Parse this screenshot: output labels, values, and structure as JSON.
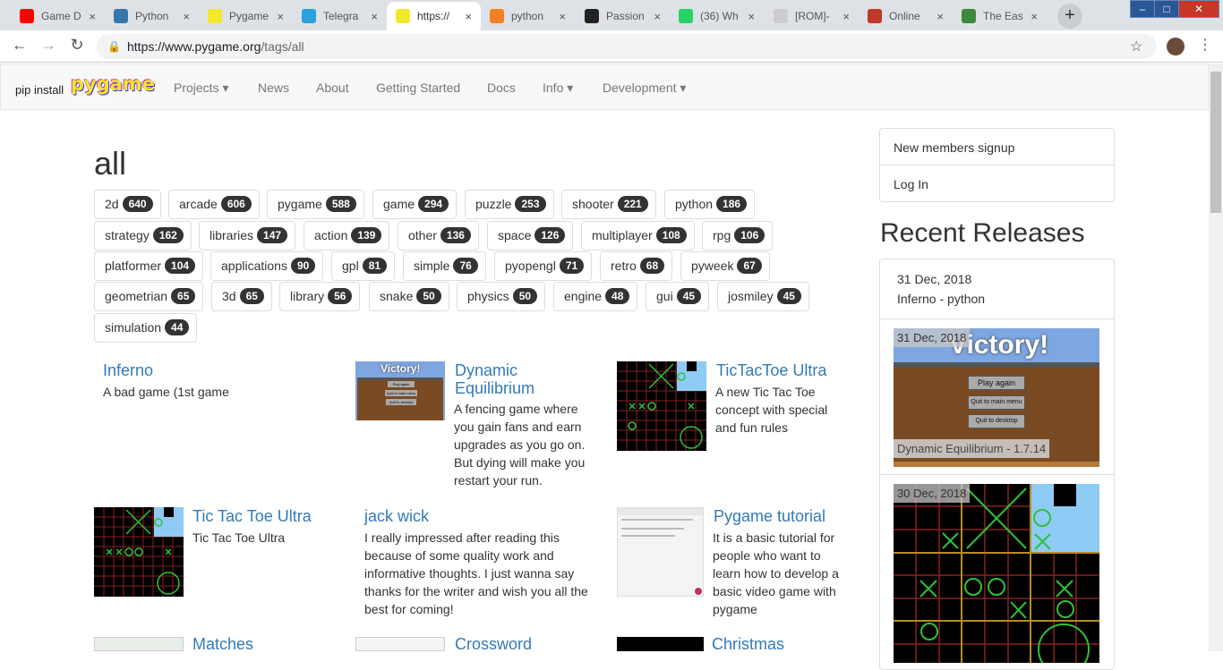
{
  "browser": {
    "tabs": [
      {
        "title": "Game D",
        "icon": "youtube-icon",
        "color": "#ff0000"
      },
      {
        "title": "Python",
        "icon": "python-icon",
        "color": "#3776ab"
      },
      {
        "title": "Pygame",
        "icon": "pygame-snake-icon",
        "color": "#f2e72a"
      },
      {
        "title": "Telegra",
        "icon": "telegram-icon",
        "color": "#2aa1da"
      },
      {
        "title": "https://",
        "icon": "pygame-snake-icon",
        "color": "#f2e72a"
      },
      {
        "title": "python",
        "icon": "stackoverflow-icon",
        "color": "#f48024"
      },
      {
        "title": "Passion",
        "icon": "github-icon",
        "color": "#222222"
      },
      {
        "title": "(36) Wh",
        "icon": "whatsapp-icon",
        "color": "#25d366"
      },
      {
        "title": "[ROM]-",
        "icon": "xda-icon",
        "color": "#cccccc"
      },
      {
        "title": "Online",
        "icon": "online-icon",
        "color": "#c0392b"
      },
      {
        "title": "The Eas",
        "icon": "sheet-icon",
        "color": "#3c8a3c"
      }
    ],
    "close_glyph": "×",
    "new_tab_glyph": "+",
    "window_controls": {
      "minimize": "–",
      "maximize": "□",
      "close": "✕"
    },
    "back_glyph": "←",
    "forward_glyph": "→",
    "reload_glyph": "↻",
    "lock_glyph": "🔒",
    "url_host": "https://www.pygame.org",
    "url_path": "/tags/all",
    "star_glyph": "☆",
    "menu_glyph": "⋮"
  },
  "nav": {
    "brand": "pip install",
    "logo": "pygame",
    "links": [
      "Projects ▾",
      "News",
      "About",
      "Getting Started",
      "Docs",
      "Info ▾",
      "Development ▾"
    ]
  },
  "heading": "all",
  "tags": [
    {
      "name": "2d",
      "count": "640"
    },
    {
      "name": "arcade",
      "count": "606"
    },
    {
      "name": "pygame",
      "count": "588"
    },
    {
      "name": "game",
      "count": "294"
    },
    {
      "name": "puzzle",
      "count": "253"
    },
    {
      "name": "shooter",
      "count": "221"
    },
    {
      "name": "python",
      "count": "186"
    },
    {
      "name": "strategy",
      "count": "162"
    },
    {
      "name": "libraries",
      "count": "147"
    },
    {
      "name": "action",
      "count": "139"
    },
    {
      "name": "other",
      "count": "136"
    },
    {
      "name": "space",
      "count": "126"
    },
    {
      "name": "multiplayer",
      "count": "108"
    },
    {
      "name": "rpg",
      "count": "106"
    },
    {
      "name": "platformer",
      "count": "104"
    },
    {
      "name": "applications",
      "count": "90"
    },
    {
      "name": "gpl",
      "count": "81"
    },
    {
      "name": "simple",
      "count": "76"
    },
    {
      "name": "pyopengl",
      "count": "71"
    },
    {
      "name": "retro",
      "count": "68"
    },
    {
      "name": "pyweek",
      "count": "67"
    },
    {
      "name": "geometrian",
      "count": "65"
    },
    {
      "name": "3d",
      "count": "65"
    },
    {
      "name": "library",
      "count": "56"
    },
    {
      "name": "snake",
      "count": "50"
    },
    {
      "name": "physics",
      "count": "50"
    },
    {
      "name": "engine",
      "count": "48"
    },
    {
      "name": "gui",
      "count": "45"
    },
    {
      "name": "josmiley",
      "count": "45"
    },
    {
      "name": "simulation",
      "count": "44"
    }
  ],
  "projects": [
    {
      "title": "Inferno",
      "desc": "A bad game (1st game"
    },
    {
      "title": "Dynamic Equilibrium",
      "title_line1": "Dynamic",
      "title_line2": "Equilibrium",
      "desc_lines": [
        "A fencing game where",
        "you gain fans and earn",
        "upgrades as you go on.",
        "But dying will make you",
        "restart your run."
      ],
      "thumb_title": "Victory!",
      "thumb_buttons": [
        "Play again",
        "Quit to main menu",
        "Quit to desktop"
      ]
    },
    {
      "title": "TicTacToe Ultra",
      "desc_lines": [
        "A new Tic Tac Toe",
        "concept with special",
        "and fun rules"
      ]
    },
    {
      "title": "Tic Tac Toe Ultra",
      "desc": "Tic Tac Toe Ultra"
    },
    {
      "title": "jack wick",
      "desc_lines": [
        "I really impressed after reading this",
        "because of some quality work and",
        "informative thoughts. I just wanna say",
        "thanks for the writer and wish you all the",
        "best for coming!"
      ]
    },
    {
      "title": "Pygame tutorial",
      "desc_lines": [
        "It is a basic tutorial for",
        "people who want to",
        "learn how to develop a",
        "basic video game with",
        "pygame"
      ]
    },
    {
      "title": "Matches"
    },
    {
      "title": "Crossword"
    },
    {
      "title": "Christmas"
    }
  ],
  "sidebar": {
    "signup": "New members signup",
    "login": "Log In",
    "recent_title": "Recent Releases",
    "releases": [
      {
        "date": "31 Dec, 2018",
        "name": "Inferno - python"
      },
      {
        "date": "31 Dec, 2018",
        "name": "Dynamic Equilibrium - 1.7.14",
        "thumb_title": "Victory!",
        "thumb_buttons": [
          "Play again",
          "Quit to main menu",
          "Quit to desktop"
        ]
      },
      {
        "date": "30 Dec, 2018"
      }
    ]
  }
}
